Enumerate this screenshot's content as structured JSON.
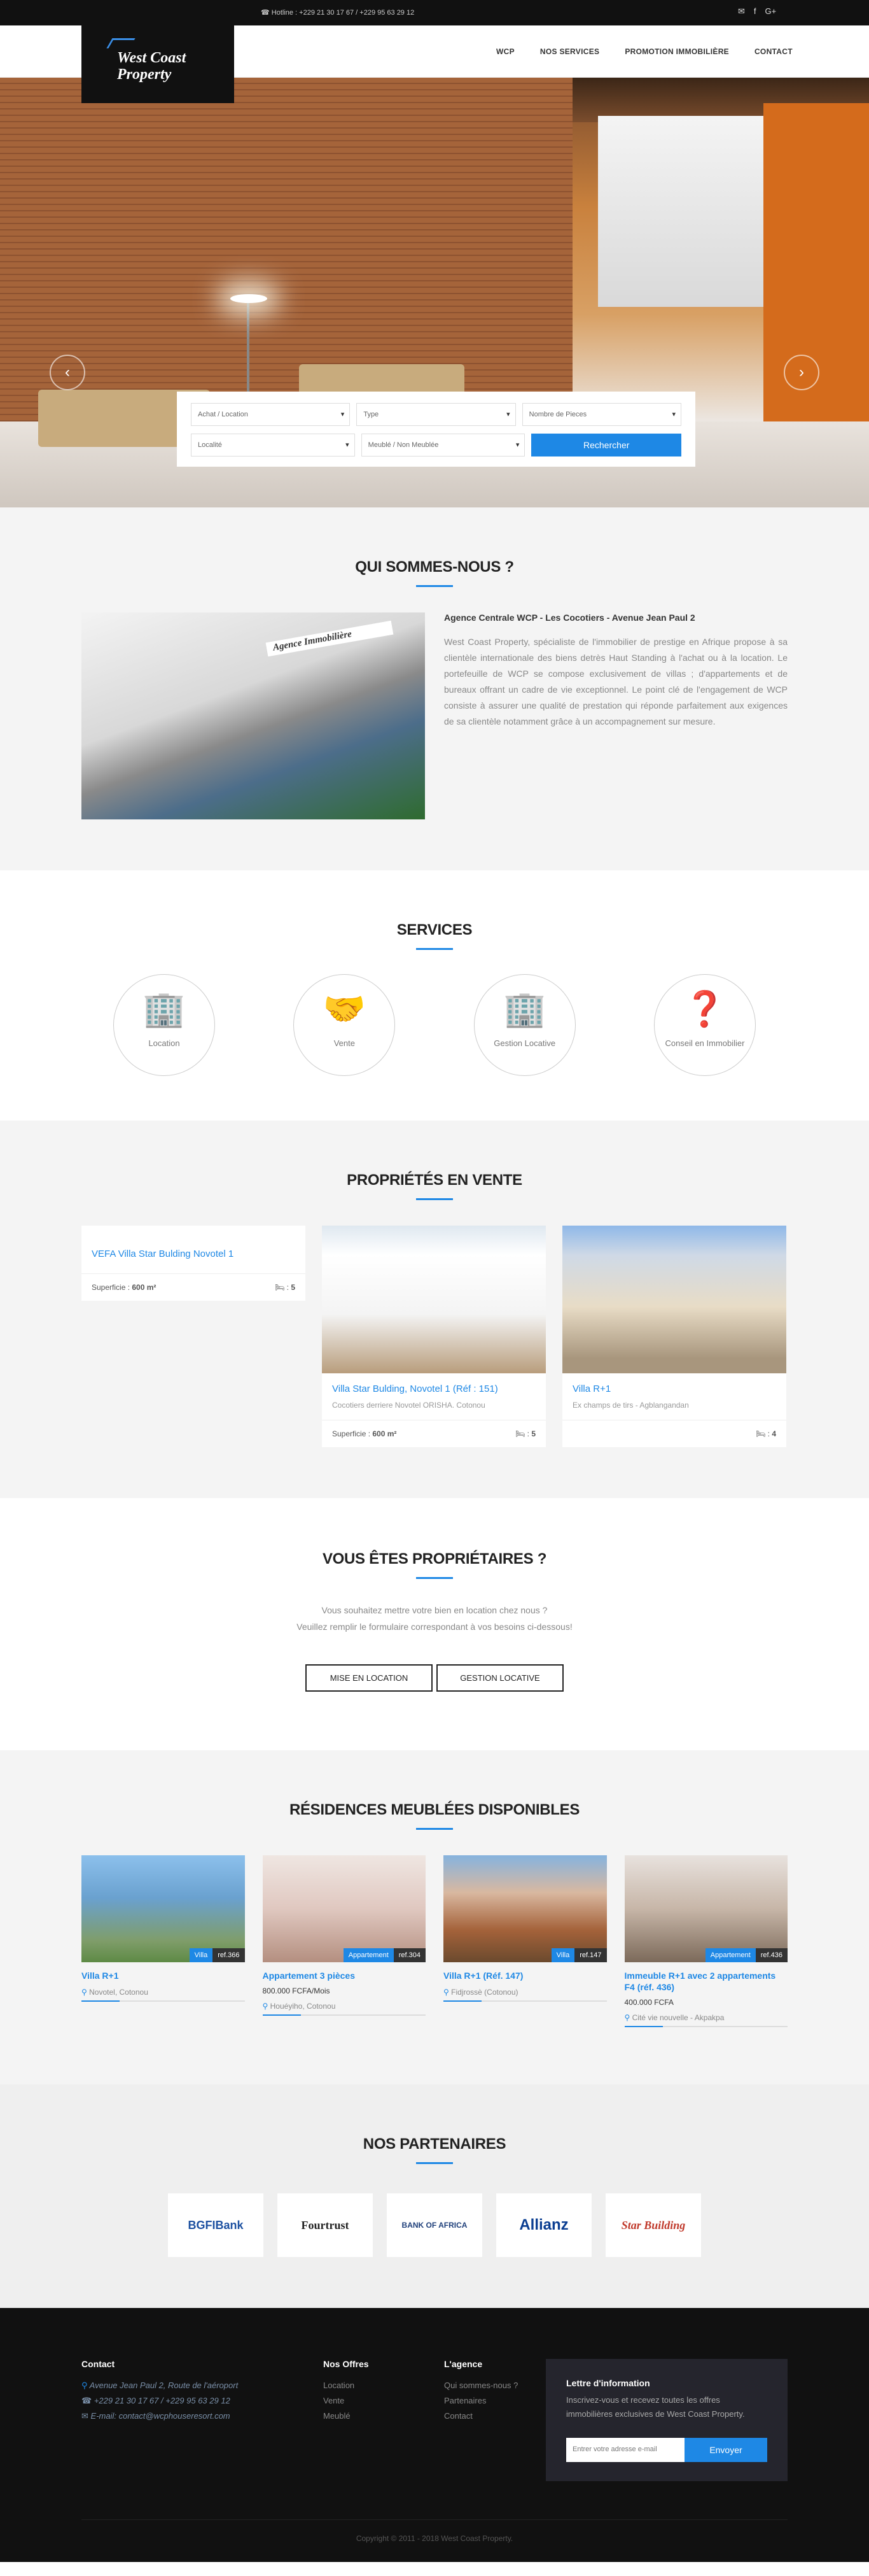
{
  "topbar": {
    "phone": "☎ Hotline : +229 21 30 17 67 / +229 95 63 29 12",
    "icons": [
      "envelope-icon",
      "facebook-icon",
      "google-plus-icon"
    ]
  },
  "logo": {
    "line1": "West Coast",
    "line2": "Property"
  },
  "nav": [
    "WCP",
    "NOS SERVICES",
    "PROMOTION IMMOBILIÈRE",
    "CONTACT"
  ],
  "search": {
    "f1": "Achat / Location",
    "f2": "Type",
    "f3": "Nombre de Pieces",
    "f4": "Localité",
    "f5": "Meublé / Non Meublée",
    "button": "Rechercher"
  },
  "about": {
    "title": "QUI SOMMES-NOUS ?",
    "heading": "Agence Centrale WCP - Les Cocotiers - Avenue Jean Paul 2",
    "text": "West Coast Property, spécialiste de l'immobilier de prestige en Afrique propose à sa clientèle internationale des biens detrès Haut Standing à l'achat ou à la location. Le portefeuille de WCP se compose exclusivement de villas ; d'appartements et de bureaux offrant un cadre de vie exceptionnel. Le point clé de l'engagement de WCP consiste à assurer une qualité de prestation qui réponde parfaitement aux exigences de sa clientèle notamment grâce à un accompagnement sur mesure.",
    "sign": "Agence Immobilière"
  },
  "services": {
    "title": "SERVICES",
    "items": [
      {
        "label": "Location",
        "icon": "building-icon",
        "glyph": "🏢"
      },
      {
        "label": "Vente",
        "icon": "handshake-icon",
        "glyph": "🤝"
      },
      {
        "label": "Gestion Locative",
        "icon": "building-icon",
        "glyph": "🏢"
      },
      {
        "label": "Conseil en Immobilier",
        "icon": "question-icon",
        "glyph": "❓"
      }
    ]
  },
  "sale": {
    "title": "PROPRIÉTÉS EN VENTE",
    "cards": [
      {
        "title": "VEFA Villa Star Bulding Novotel 1",
        "sub": "",
        "surface_label": "Superficie :",
        "surface": "600 m²",
        "rooms": "5"
      },
      {
        "title": "Villa Star Bulding, Novotel 1 (Réf : 151)",
        "sub": "Cocotiers derriere Novotel ORISHA. Cotonou",
        "surface_label": "Superficie :",
        "surface": "600 m²",
        "rooms": "5"
      },
      {
        "title": "Villa R+1",
        "sub": "Ex champs de tirs - Agblangandan",
        "surface_label": "",
        "surface": "",
        "rooms": "4"
      }
    ]
  },
  "owners": {
    "title": "VOUS ÊTES PROPRIÉTAIRES ?",
    "line1": "Vous souhaitez mettre votre bien en location chez nous ?",
    "line2": "Veuillez remplir le formulaire correspondant à vos besoins ci-dessous!",
    "b1": "MISE EN LOCATION",
    "b2": "GESTION LOCATIVE"
  },
  "res": {
    "title": "RÉSIDENCES MEUBLÉES DISPONIBLES",
    "items": [
      {
        "type": "Villa",
        "ref": "ref.366",
        "name": "Villa R+1",
        "price": "",
        "loc": "Novotel, Cotonou"
      },
      {
        "type": "Appartement",
        "ref": "ref.304",
        "name": "Appartement 3 pièces",
        "price": "800.000 FCFA/Mois",
        "loc": "Houéyiho, Cotonou"
      },
      {
        "type": "Villa",
        "ref": "ref.147",
        "name": "Villa R+1 (Réf. 147)",
        "price": "",
        "loc": "Fidjrossè (Cotonou)"
      },
      {
        "type": "Appartement",
        "ref": "ref.436",
        "name": "Immeuble R+1 avec 2 appartements F4 (réf. 436)",
        "price": "400.000 FCFA",
        "loc": "Cité vie nouvelle - Akpakpa"
      }
    ]
  },
  "partners": {
    "title": "NOS PARTENAIRES",
    "items": [
      "BGFIBank",
      "Fourtrust",
      "BANK OF AFRICA",
      "Allianz",
      "Star Building"
    ]
  },
  "footer": {
    "contact_title": "Contact",
    "contact": [
      "Avenue Jean Paul 2, Route de l'aéroport",
      "+229 21 30 17 67 / +229 95 63 29 12",
      "E-mail: contact@wcphouseresort.com"
    ],
    "offres_title": "Nos Offres",
    "offres": [
      "Location",
      "Vente",
      "Meublé"
    ],
    "agence_title": "L'agence",
    "agence": [
      "Qui sommes-nous ?",
      "Partenaires",
      "Contact"
    ],
    "news_title": "Lettre d'information",
    "news_text": "Inscrivez-vous et recevez toutes les offres immobilières exclusives de West Coast Property.",
    "news_placeholder": "Entrer votre adresse e-mail",
    "news_btn": "Envoyer",
    "copy": "Copyright © 2011 - 2018 West Coast Property."
  }
}
